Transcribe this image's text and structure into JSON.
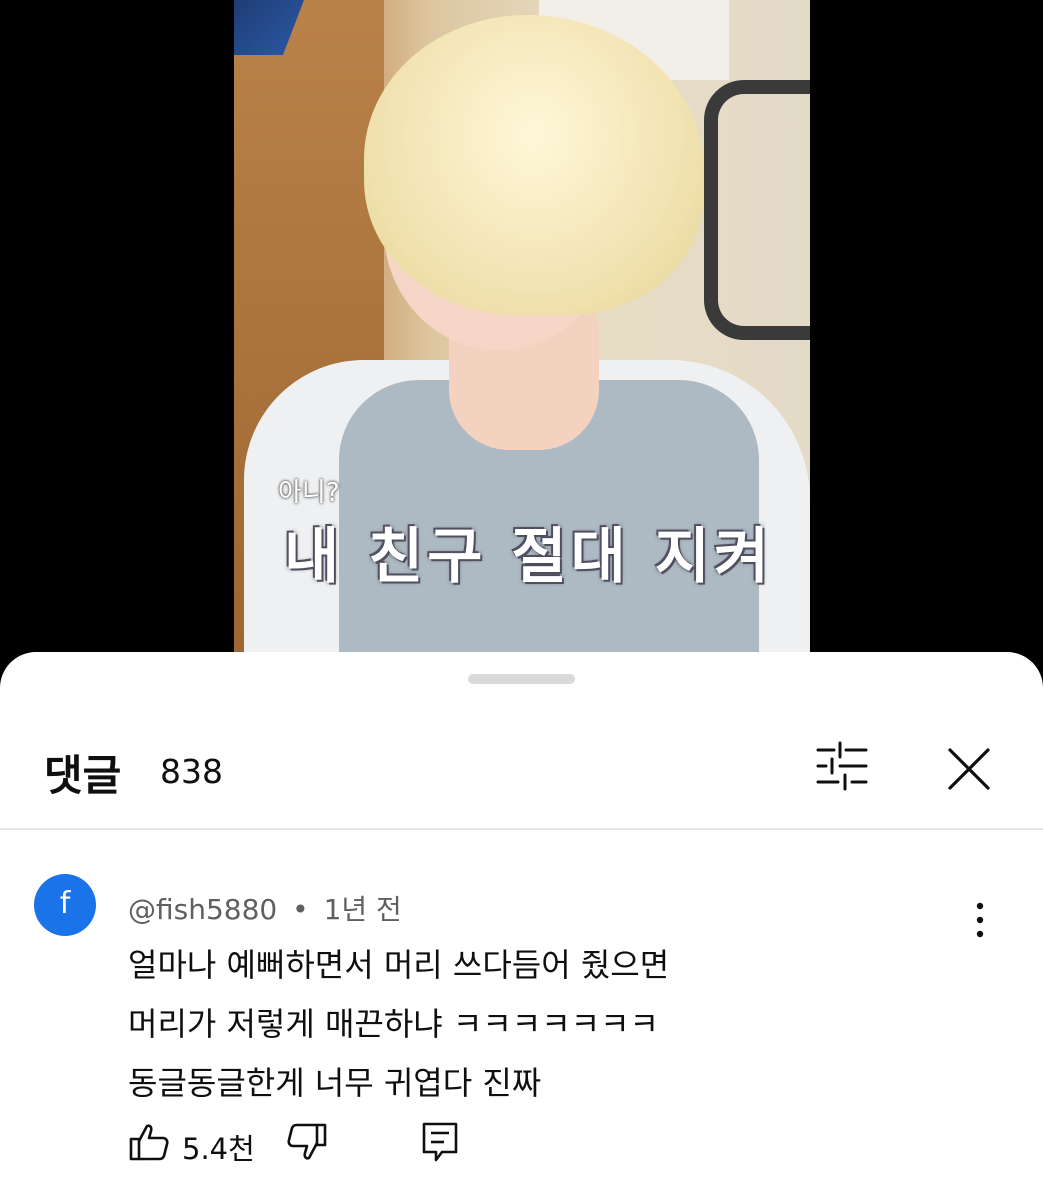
{
  "video": {
    "subtitle_small": "아니?",
    "subtitle_big": "내 친구 절대 지켜"
  },
  "comments_panel": {
    "title": "댓글",
    "count": "838",
    "icons": {
      "filter": "sliders-icon",
      "close": "close-icon"
    }
  },
  "comment": {
    "avatar_letter": "f",
    "avatar_color": "#1a73e8",
    "author": "@fish5880",
    "separator": "•",
    "time": "1년 전",
    "lines": [
      "얼마나 예뻐하면서 머리 쓰다듬어 줬으면",
      "머리가 저렇게 매끈하냐 ㅋㅋㅋㅋㅋㅋㅋ",
      "동글동글한게 너무 귀엽다 진짜"
    ],
    "likes": "5.4천",
    "icons": {
      "like": "thumbs-up-icon",
      "dislike": "thumbs-down-icon",
      "reply": "reply-icon",
      "more": "more-vertical-icon"
    }
  }
}
